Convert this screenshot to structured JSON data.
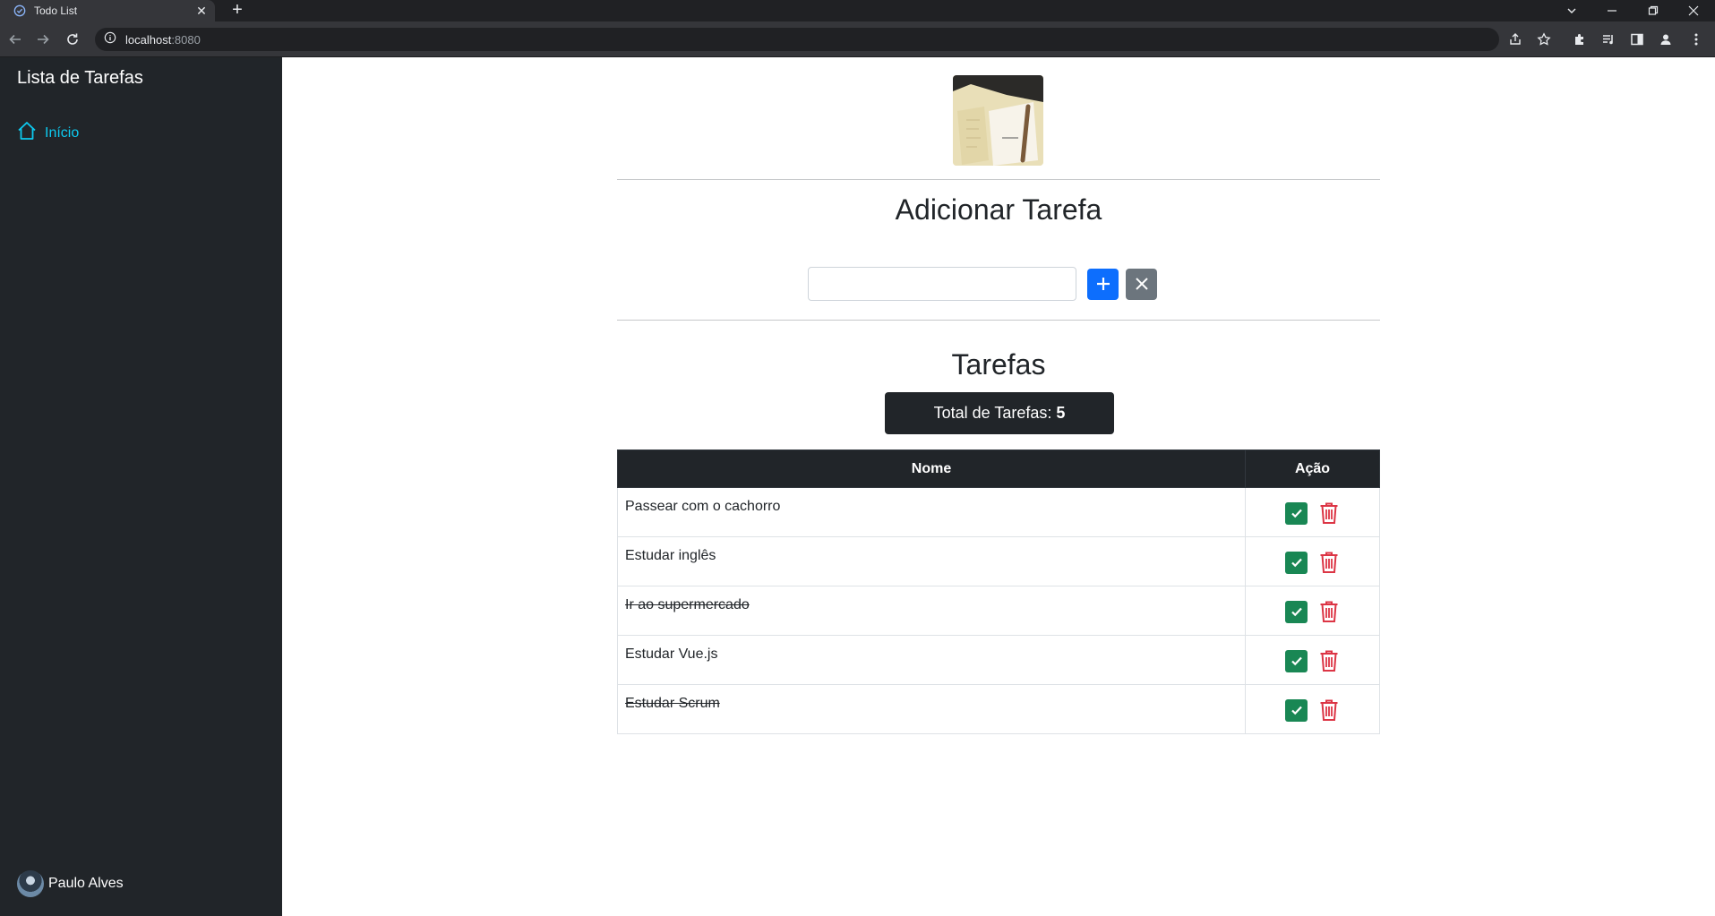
{
  "browser": {
    "tab_title": "Todo List",
    "url_host": "localhost",
    "url_port": ":8080"
  },
  "sidebar": {
    "brand": "Lista de Tarefas",
    "nav": [
      {
        "label": "Início",
        "icon": "home-icon"
      }
    ],
    "user_name": "Paulo Alves"
  },
  "main": {
    "add_heading": "Adicionar Tarefa",
    "input_value": "",
    "tasks_heading": "Tarefas",
    "total_label": "Total de Tarefas:",
    "total_count": "5",
    "table": {
      "headers": [
        "Nome",
        "Ação"
      ],
      "rows": [
        {
          "name": "Passear com o cachorro",
          "done": false
        },
        {
          "name": "Estudar inglês",
          "done": false
        },
        {
          "name": "Ir ao supermercado",
          "done": true
        },
        {
          "name": "Estudar Vue.js",
          "done": false
        },
        {
          "name": "Estudar Scrum",
          "done": true
        }
      ]
    }
  },
  "colors": {
    "sidebar_bg": "#212529",
    "accent_link": "#0dcaf0",
    "primary": "#0d6efd",
    "secondary": "#6c757d",
    "success": "#198754",
    "danger": "#dc3545"
  }
}
